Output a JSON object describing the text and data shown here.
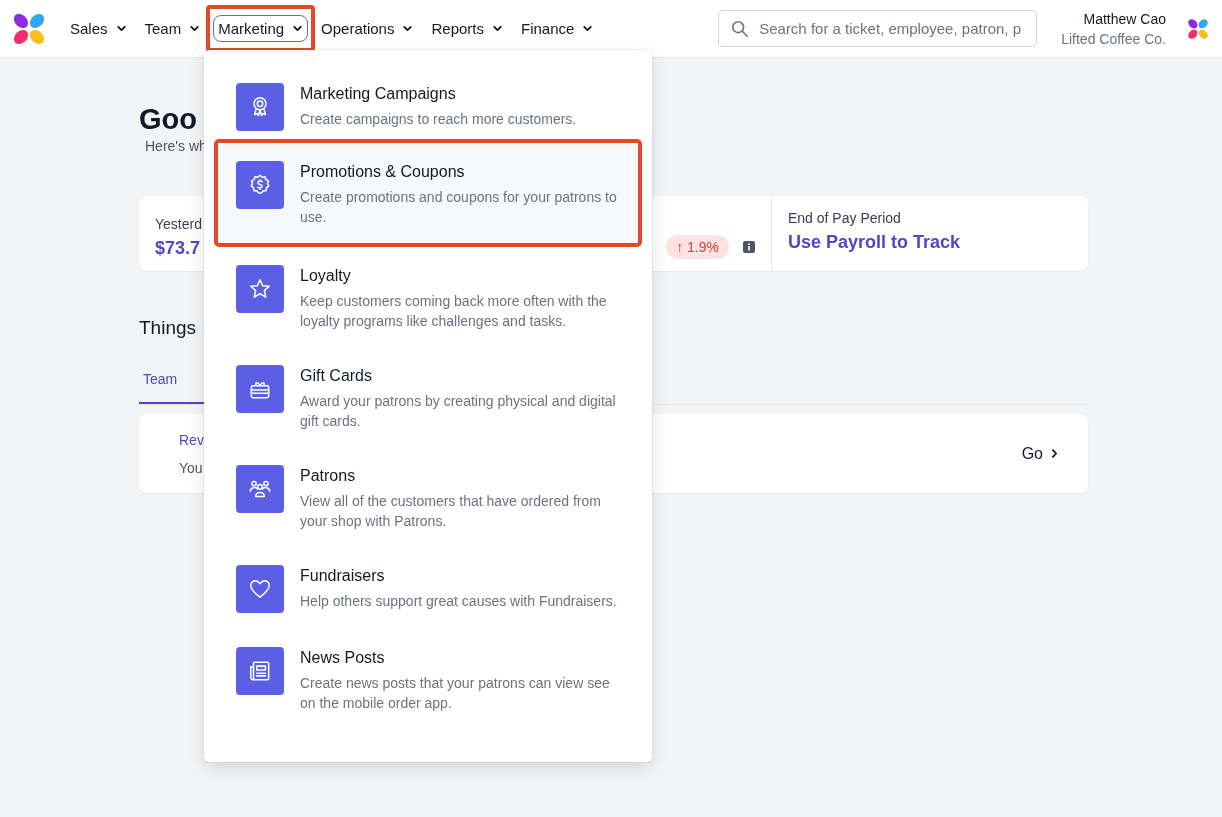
{
  "nav": [
    {
      "label": "Sales",
      "selected": false,
      "highlighted": false
    },
    {
      "label": "Team",
      "selected": false,
      "highlighted": false
    },
    {
      "label": "Marketing",
      "selected": true,
      "highlighted": true
    },
    {
      "label": "Operations",
      "selected": false,
      "highlighted": false
    },
    {
      "label": "Reports",
      "selected": false,
      "highlighted": false
    },
    {
      "label": "Finance",
      "selected": false,
      "highlighted": false
    }
  ],
  "search": {
    "placeholder": "Search for a ticket, employee, patron, p"
  },
  "user": {
    "name": "Matthew Cao",
    "company": "Lifted Coffee Co."
  },
  "greeting": {
    "title": "Goo",
    "subtitle": "Here's wh"
  },
  "stats": {
    "label": "Yesterd",
    "value": "$73.7",
    "change": "1.9%",
    "change_arrow": "↑",
    "pay_label": "End of Pay Period",
    "pay_value": "Use Payroll to Track"
  },
  "todo": {
    "title": "Things",
    "tab": "Team",
    "task_title": "Rev",
    "task_text": "You",
    "go": "Go"
  },
  "menu": [
    {
      "kind": "award",
      "title": "Marketing Campaigns",
      "description": "Create campaigns to reach more customers.",
      "highlighted": false
    },
    {
      "kind": "coupon",
      "title": "Promotions & Coupons",
      "description": "Create promotions and coupons for your patrons to use.",
      "highlighted": true
    },
    {
      "kind": "star",
      "title": "Loyalty",
      "description": "Keep customers coming back more often with the loyalty programs like challenges and tasks.",
      "highlighted": false
    },
    {
      "kind": "gift",
      "title": "Gift Cards",
      "description": "Award your patrons by creating physical and digital gift cards.",
      "highlighted": false
    },
    {
      "kind": "people",
      "title": "Patrons",
      "description": "View all of the customers that have ordered from your shop with Patrons.",
      "highlighted": false
    },
    {
      "kind": "heart",
      "title": "Fundraisers",
      "description": "Help others support great causes with Fundraisers.",
      "highlighted": false
    },
    {
      "kind": "news",
      "title": "News Posts",
      "description": "Create news posts that your patrons can view see on the mobile order app.",
      "highlighted": false
    }
  ]
}
